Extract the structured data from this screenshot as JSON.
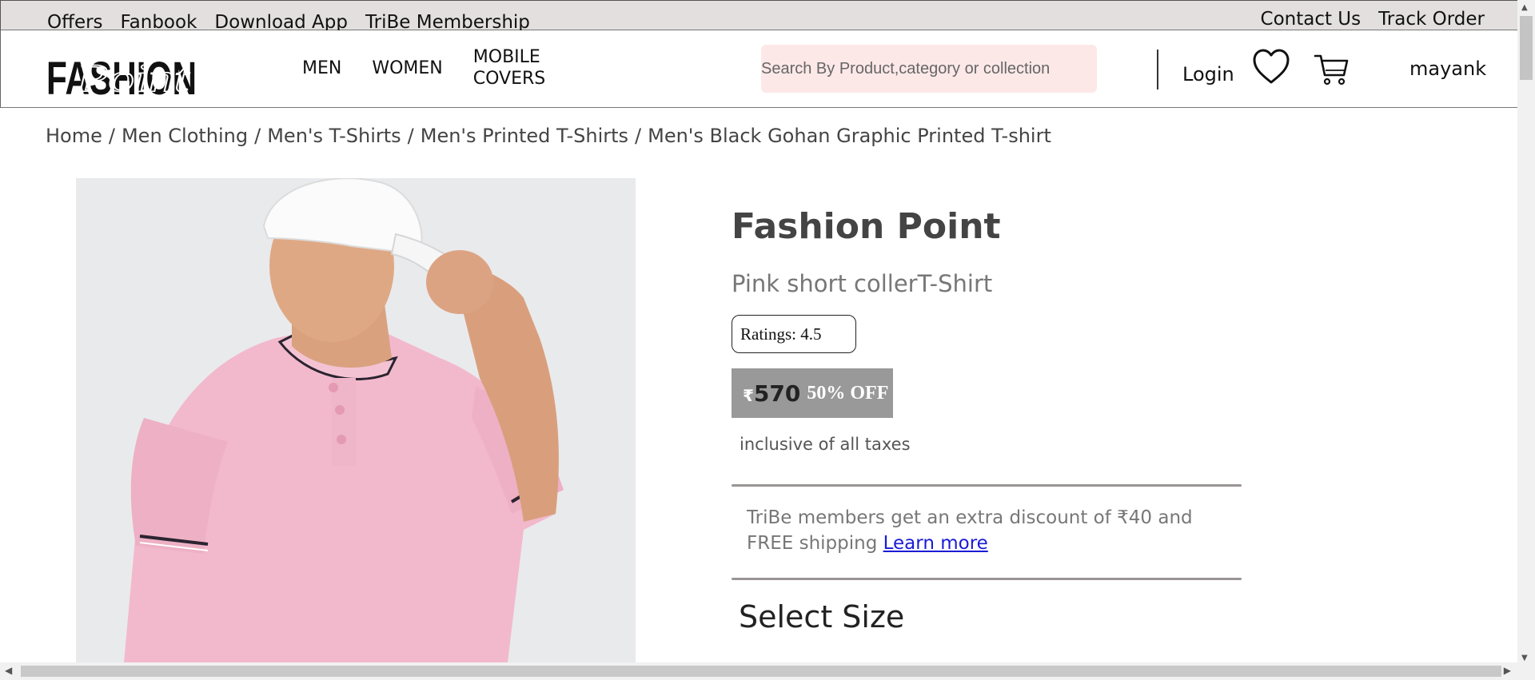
{
  "topbar": {
    "left_links": [
      "Offers",
      "Fanbook",
      "Download App",
      "TriBe Membership"
    ],
    "right_links": [
      "Contact Us",
      "Track Order"
    ]
  },
  "header": {
    "logo_text_main": "FASHION",
    "logo_text_script": "Point",
    "nav": [
      "MEN",
      "WOMEN",
      "MOBILE",
      "COVERS"
    ],
    "search_placeholder": "Search By Product,category or collection",
    "login_label": "Login",
    "username": "mayank"
  },
  "breadcrumb": [
    "Home",
    "Men Clothing",
    "Men's T-Shirts",
    "Men's Printed T-Shirts",
    "Men's Black Gohan Graphic Printed T-shirt"
  ],
  "breadcrumb_separator": "/",
  "product": {
    "brand": "Fashion Point",
    "name": "Pink short collerT-Shirt",
    "rating_label": "Ratings: 4.5",
    "currency": "₹",
    "price": "570",
    "discount": "50% OFF",
    "tax_note": "inclusive of all taxes",
    "tribe_text": "TriBe members get an extra discount of ₹40 and FREE shipping",
    "tribe_link": "Learn more",
    "select_size_label": "Select Size"
  },
  "colors": {
    "topbar_bg": "#e3dfdf",
    "search_bg": "#fde8e8",
    "price_box_bg": "#999999",
    "link_blue": "#1b1bd6",
    "shirt_pink": "#f2b9cc"
  }
}
